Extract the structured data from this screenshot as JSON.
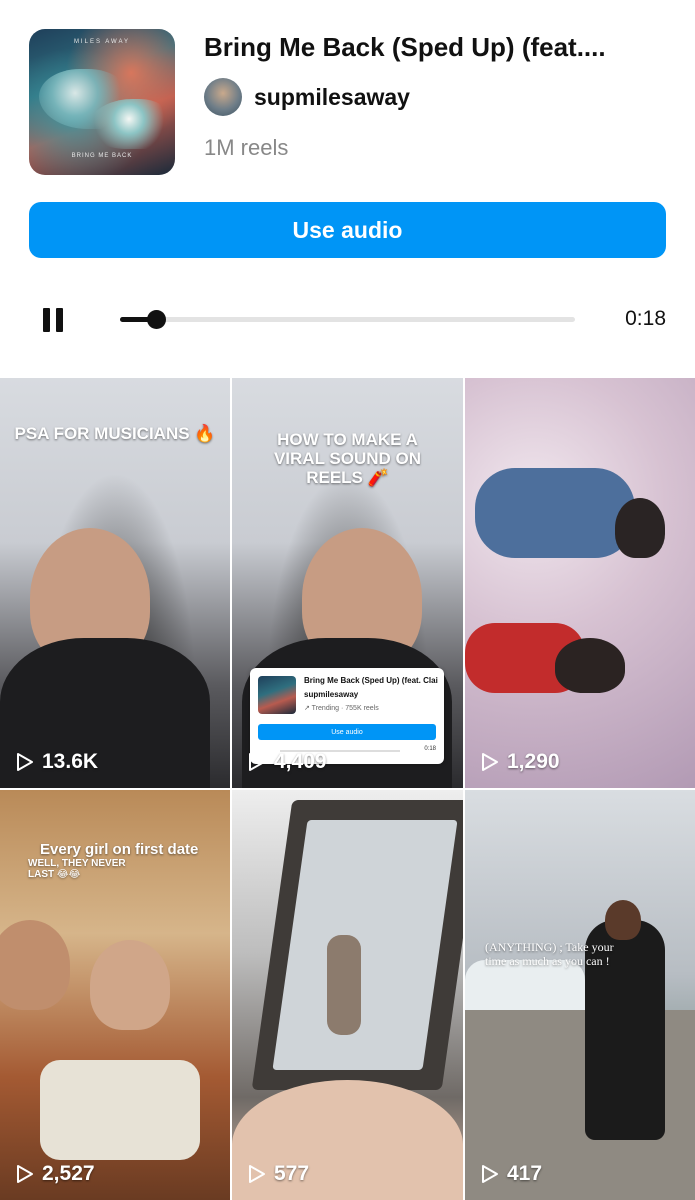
{
  "audio": {
    "cover_top_text": "MILES AWAY",
    "cover_bottom_text": "BRING ME BACK",
    "title": "Bring Me Back (Sped Up) (feat....",
    "artist": "supmilesaway",
    "reels_count": "1M reels",
    "use_audio_label": "Use audio"
  },
  "player": {
    "state": "playing",
    "progress": 0.08,
    "time": "0:18"
  },
  "reels": [
    {
      "caption": "PSA FOR MUSICIANS 🔥",
      "views": "13.6K"
    },
    {
      "caption": "HOW TO MAKE A VIRAL SOUND ON REELS 🧨",
      "views": "4,409",
      "card": {
        "title": "Bring Me Back (Sped Up) (feat. Clai...",
        "artist": "supmilesaway",
        "trend": "↗ Trending · 755K reels",
        "button": "Use audio",
        "time": "0:18"
      }
    },
    {
      "caption": "",
      "views": "1,290"
    },
    {
      "caption": "Every girl on first date",
      "caption_2": "WELL, THEY NEVER LAST 😂😂",
      "views": "2,527"
    },
    {
      "caption": "",
      "views": "577"
    },
    {
      "caption": "(ANYTHING) ; Take your time as much as you can !",
      "views": "417"
    }
  ],
  "colors": {
    "accent": "#0095f6",
    "muted": "#888888"
  }
}
